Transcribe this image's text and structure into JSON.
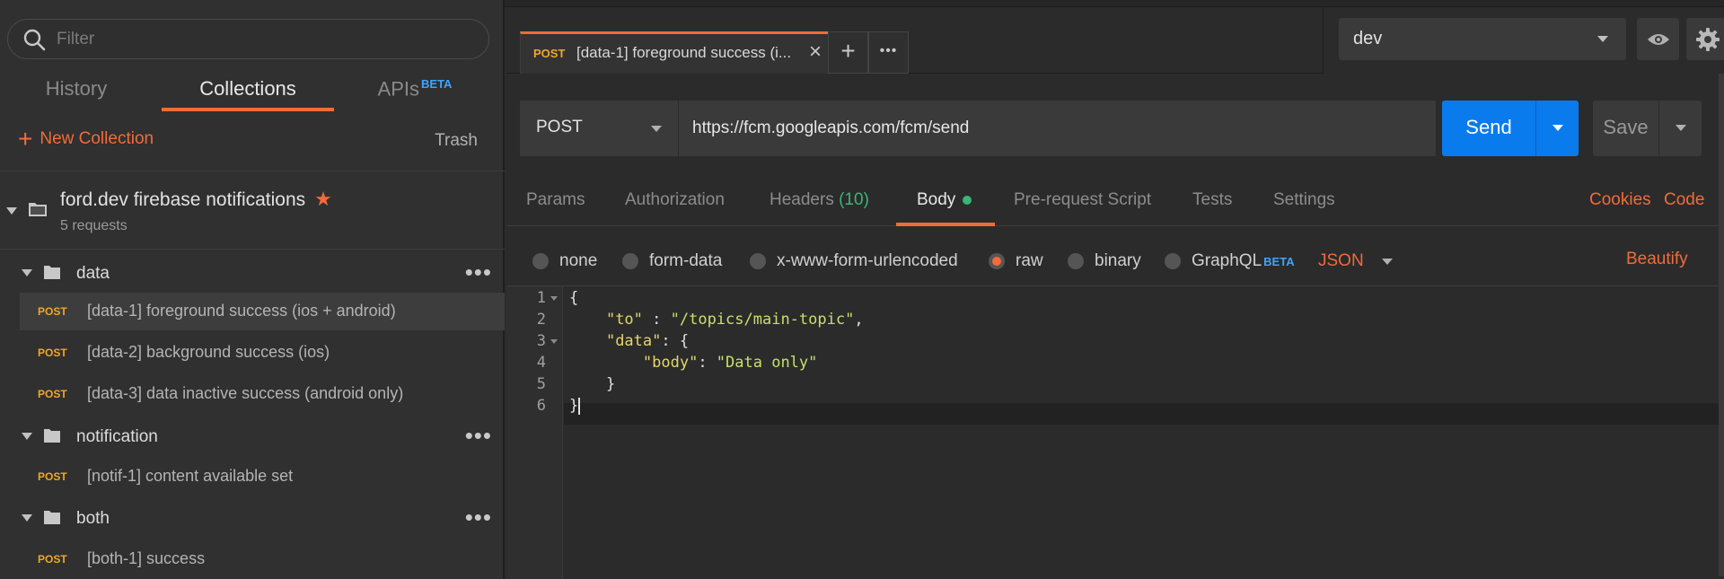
{
  "sidebar": {
    "filter_placeholder": "Filter",
    "tabs": [
      {
        "label": "History"
      },
      {
        "label": "Collections"
      },
      {
        "label": "APIs",
        "badge": "BETA"
      }
    ],
    "new_collection_label": "New Collection",
    "trash_label": "Trash",
    "collection": {
      "name": "ford.dev firebase notifications",
      "subtitle": "5 requests"
    },
    "folders": [
      {
        "name": "data"
      },
      {
        "name": "notification"
      },
      {
        "name": "both"
      }
    ],
    "requests": [
      {
        "method": "POST",
        "name": "[data-1] foreground success (ios + android)"
      },
      {
        "method": "POST",
        "name": "[data-2] background success (ios)"
      },
      {
        "method": "POST",
        "name": "[data-3] data inactive success (android only)"
      },
      {
        "method": "POST",
        "name": "[notif-1] content available set"
      },
      {
        "method": "POST",
        "name": "[both-1] success"
      }
    ]
  },
  "tabbar": {
    "tab": {
      "method": "POST",
      "name": "[data-1] foreground success (i..."
    },
    "add_label": "+",
    "more_label": "•••"
  },
  "environment": {
    "selected": "dev"
  },
  "request": {
    "method": "POST",
    "url": "https://fcm.googleapis.com/fcm/send",
    "send_label": "Send",
    "save_label": "Save"
  },
  "request_tabs": {
    "params": "Params",
    "authorization": "Authorization",
    "headers": "Headers",
    "headers_count": "(10)",
    "body": "Body",
    "pre_request": "Pre-request Script",
    "tests": "Tests",
    "settings": "Settings",
    "cookies": "Cookies",
    "code": "Code"
  },
  "body_types": {
    "none": "none",
    "form_data": "form-data",
    "urlencoded": "x-www-form-urlencoded",
    "raw": "raw",
    "binary": "binary",
    "graphql": "GraphQL",
    "graphql_badge": "BETA",
    "format": "JSON",
    "beautify": "Beautify"
  },
  "editor": {
    "line_numbers": [
      "1",
      "2",
      "3",
      "4",
      "5",
      "6"
    ],
    "tokens": {
      "l1": "{",
      "l2_key": "\"to\"",
      "l2_sep": " : ",
      "l2_val": "\"/topics/main-topic\"",
      "l2_end": ",",
      "l3_key": "\"data\"",
      "l3_end": ": {",
      "l4_key": "\"body\"",
      "l4_sep": ": ",
      "l4_val": "\"Data only\"",
      "l5": "}",
      "l6": "}"
    }
  },
  "colors": {
    "accent": "#f26b3a",
    "send": "#097bed",
    "method_post": "#f0a728",
    "success": "#37b67a",
    "beta": "#3ea4ff"
  }
}
